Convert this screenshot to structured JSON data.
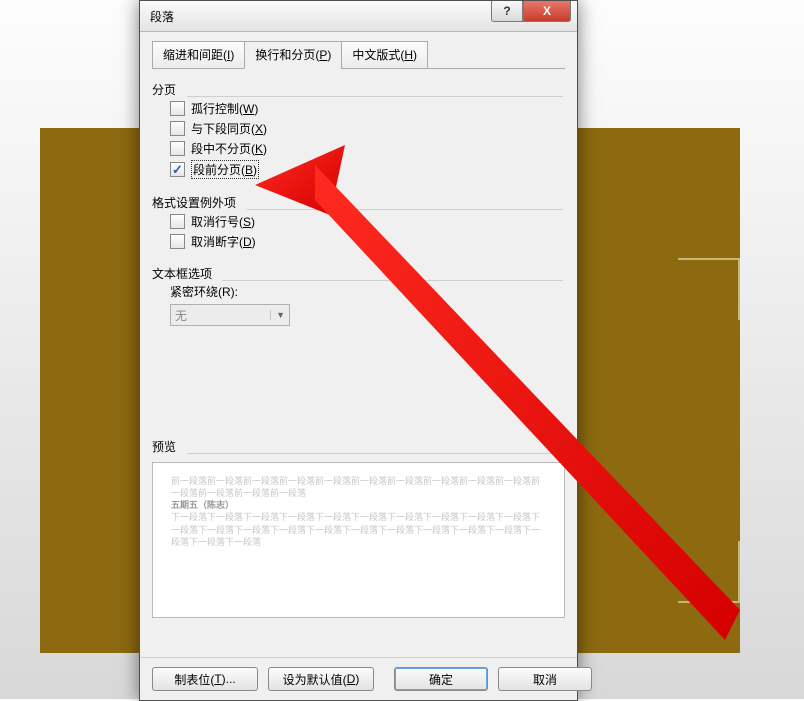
{
  "dialog": {
    "title": "段落",
    "help_btn": "?",
    "close_btn": "X"
  },
  "tabs": {
    "indent": {
      "text": "缩进和间距(",
      "key": "I",
      "suffix": ")"
    },
    "breaks": {
      "text": "换行和分页(",
      "key": "P",
      "suffix": ")"
    },
    "cjk": {
      "text": "中文版式(",
      "key": "H",
      "suffix": ")"
    }
  },
  "sections": {
    "pagination": {
      "label": "分页",
      "options": {
        "widow": {
          "text": "孤行控制(",
          "key": "W",
          "suffix": ")",
          "checked": false
        },
        "keep_next": {
          "text": "与下段同页(",
          "key": "X",
          "suffix": ")",
          "checked": false
        },
        "keep_tog": {
          "text": "段中不分页(",
          "key": "K",
          "suffix": ")",
          "checked": false
        },
        "pg_before": {
          "text": "段前分页(",
          "key": "B",
          "suffix": ")",
          "checked": true
        }
      }
    },
    "exceptions": {
      "label": "格式设置例外项",
      "options": {
        "no_line_num": {
          "text": "取消行号(",
          "key": "S",
          "suffix": ")",
          "checked": false
        },
        "no_hyphen": {
          "text": "取消断字(",
          "key": "D",
          "suffix": ")",
          "checked": false
        }
      }
    },
    "textbox": {
      "label": "文本框选项",
      "wrap_label": {
        "text": "紧密环绕(",
        "key": "R",
        "suffix": "):"
      },
      "wrap_value": "无"
    },
    "preview": {
      "label": "预览",
      "line1": "前一段落前一段落前一段落前一段落前一段落前一段落前一段落前一段落前一段落前一段落前一段落前一段落前一段落前一段落",
      "bold": "五期五（陈志）",
      "line2": "下一段落下一段落下一段落下一段落下一段落下一段落下一段落下一段落下一段落下一段落下一段落下一段落下一段落下一段落下一段落下一段落下一段落下一段落下一段落下一段落下一段落下一段落下一段落"
    }
  },
  "buttons": {
    "tabs": {
      "text": "制表位(",
      "key": "T",
      "suffix": ")..."
    },
    "default": {
      "text": "设为默认值(",
      "key": "D",
      "suffix": ")"
    },
    "ok": "确定",
    "cancel": "取消"
  }
}
